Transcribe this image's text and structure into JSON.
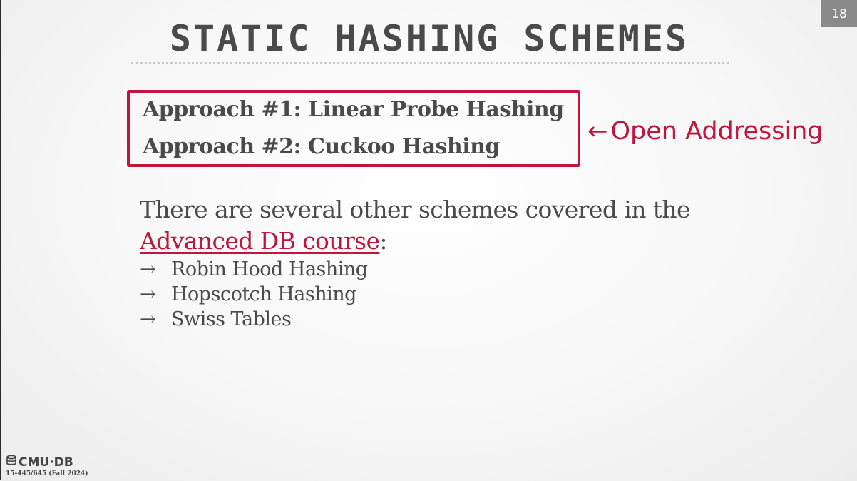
{
  "slide": {
    "page_number": "18",
    "title": "STATIC HASHING SCHEMES",
    "approaches": [
      "Approach #1: Linear Probe Hashing",
      "Approach #2: Cuckoo Hashing"
    ],
    "annotation": {
      "arrow": "←",
      "text": "Open Addressing"
    },
    "body": {
      "text_before": "There are several other schemes covered in the",
      "link_text": "Advanced DB course",
      "text_after": ":"
    },
    "bullets": [
      {
        "arrow": "→",
        "text": "Robin Hood Hashing"
      },
      {
        "arrow": "→",
        "text": "Hopscotch Hashing"
      },
      {
        "arrow": "→",
        "text": "Swiss Tables"
      }
    ]
  },
  "footer": {
    "logo_text": "CMU·DB",
    "icon": "database-icon",
    "course": "15-445/645 (Fall 2024)"
  },
  "colors": {
    "accent": "#c0163c",
    "text": "#4a4a4a",
    "page_badge": "#8a8a8a"
  }
}
